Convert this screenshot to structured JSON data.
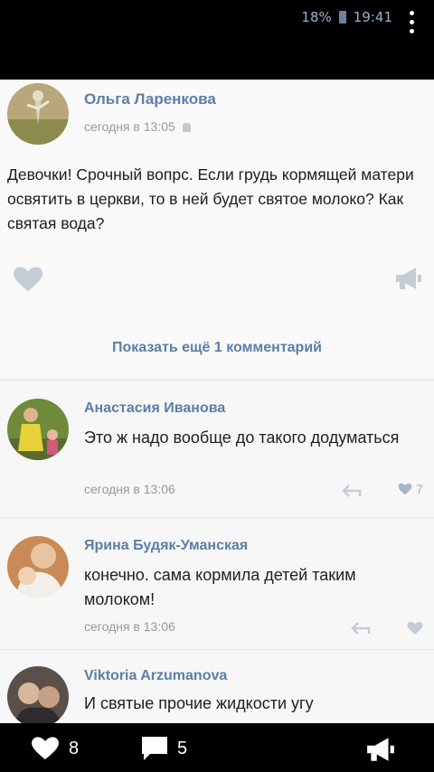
{
  "status": {
    "battery": "18%",
    "time": "19:41"
  },
  "post": {
    "author": "Ольга Ларенкова",
    "time": "сегодня в 13:05",
    "text": "Девочки! Срочный вопрс. Если грудь кормящей матери освятить в церкви, то в ней будет святое молоко? Как святая вода?"
  },
  "show_more": "Показать ещё 1 комментарий",
  "comments": [
    {
      "author": "Анастасия Иванова",
      "text": "Это ж надо вообще до такого додуматься",
      "time": "сегодня в 13:06",
      "likes": "7"
    },
    {
      "author": "Ярина Будяк-Уманская",
      "text": "конечно. сама кормила детей таким молоком!",
      "time": "сегодня в 13:06",
      "likes": ""
    },
    {
      "author": "Viktoria Arzumanova",
      "text": "И святые прочие жидкости угу"
    }
  ],
  "bottom": {
    "likes": "8",
    "comments": "5"
  },
  "colors": {
    "link": "#5b7fa7",
    "icon": "#c4ccd6",
    "bar": "#000000"
  }
}
